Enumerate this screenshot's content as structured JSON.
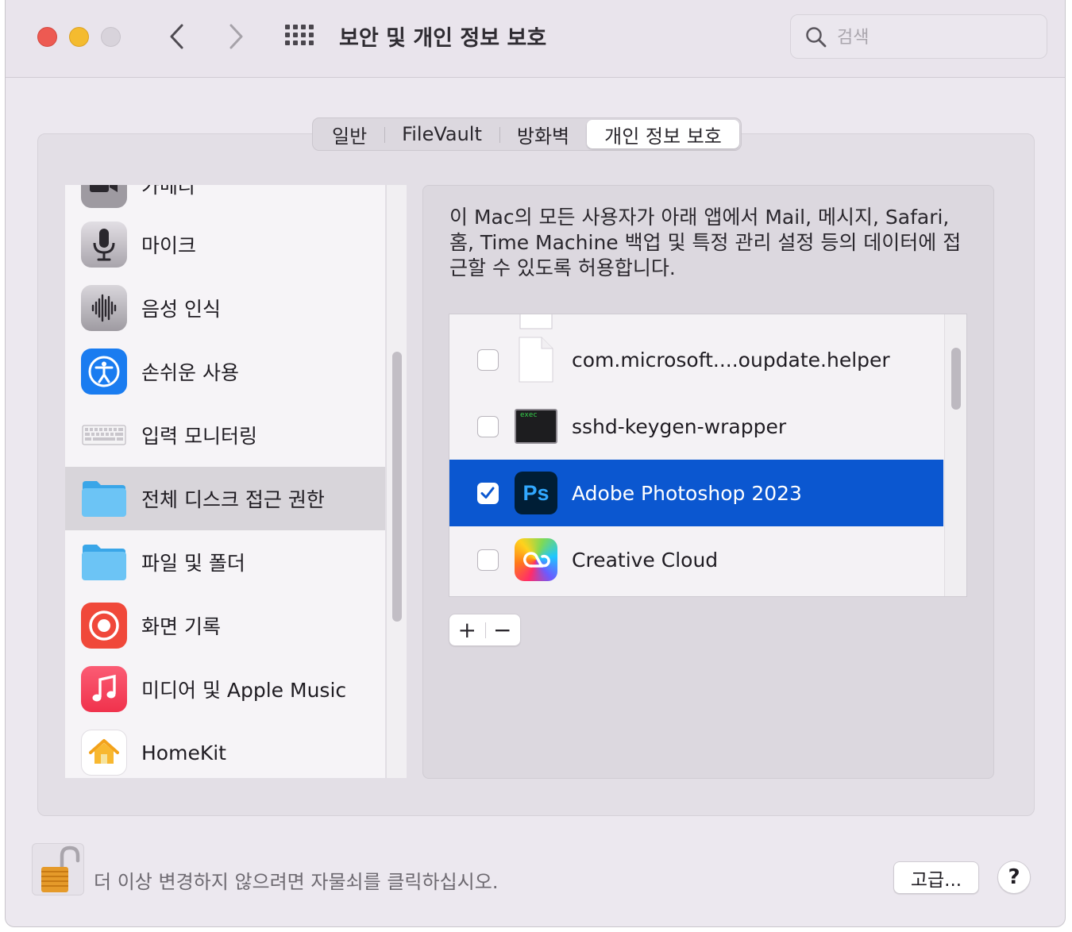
{
  "window": {
    "title": "보안 및 개인 정보 보호",
    "search_placeholder": "검색"
  },
  "tabs": [
    {
      "label": "일반",
      "active": false
    },
    {
      "label": "FileVault",
      "active": false
    },
    {
      "label": "방화벽",
      "active": false
    },
    {
      "label": "개인 정보 보호",
      "active": true
    }
  ],
  "sidebar": {
    "items": [
      {
        "label": "카메라",
        "icon": "camera-icon"
      },
      {
        "label": "마이크",
        "icon": "microphone-icon"
      },
      {
        "label": "음성 인식",
        "icon": "waveform-icon"
      },
      {
        "label": "손쉬운 사용",
        "icon": "accessibility-icon"
      },
      {
        "label": "입력 모니터링",
        "icon": "keyboard-icon"
      },
      {
        "label": "전체 디스크 접근 권한",
        "icon": "folder-icon",
        "selected": true
      },
      {
        "label": "파일 및 폴더",
        "icon": "folder-icon"
      },
      {
        "label": "화면 기록",
        "icon": "screen-record-icon"
      },
      {
        "label": "미디어 및 Apple Music",
        "icon": "music-icon"
      },
      {
        "label": "HomeKit",
        "icon": "home-icon"
      }
    ]
  },
  "main": {
    "description": "이 Mac의 모든 사용자가 아래 앱에서 Mail, 메시지, Safari, 홈, Time Machine 백업 및 특정 관리 설정 등의 데이터에 접근할 수 있도록 허용합니다.",
    "apps": [
      {
        "name": "com.microsoft....oupdate.helper",
        "checked": false,
        "icon": "document-icon"
      },
      {
        "name": "sshd-keygen-wrapper",
        "checked": false,
        "icon": "terminal-exec-icon",
        "icon_text": "exec"
      },
      {
        "name": "Adobe Photoshop 2023",
        "checked": true,
        "selected": true,
        "icon": "photoshop-icon",
        "icon_text": "Ps"
      },
      {
        "name": "Creative Cloud",
        "checked": false,
        "icon": "creative-cloud-icon"
      }
    ],
    "add_label": "+",
    "remove_label": "−"
  },
  "footer": {
    "lock_text": "더 이상 변경하지 않으려면 자물쇠를 클릭하십시오.",
    "advanced_label": "고급...",
    "help_label": "?"
  },
  "colors": {
    "selection": "#0b57d0",
    "window_bg": "#ece8ef"
  }
}
